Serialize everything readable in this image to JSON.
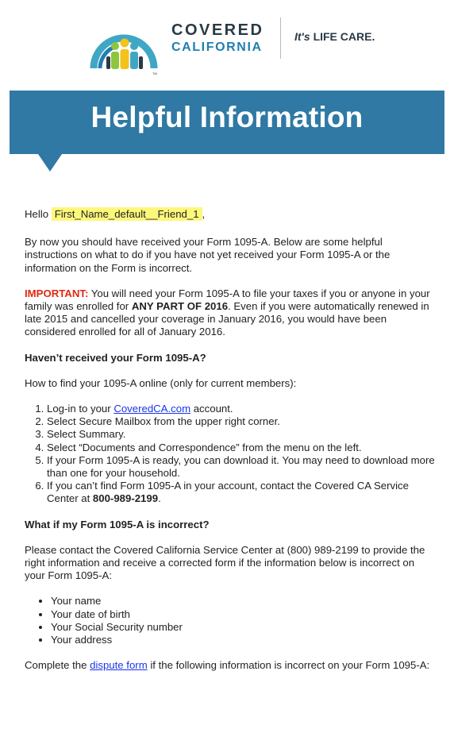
{
  "header": {
    "brand_line1": "COVERED",
    "brand_line2": "CALIFORNIA",
    "tm": "TM",
    "tagline_its": "It's",
    "tagline_rest": "LIFE CARE."
  },
  "banner": {
    "title": "Helpful Information"
  },
  "greeting": {
    "prefix": "Hello",
    "name": "First_Name_default__Friend_1",
    "suffix": ","
  },
  "intro": "By now you should have received your Form 1095-A. Below are some helpful instructions on what to do if you have not yet received your Form 1095-A or the information on the Form is incorrect.",
  "important": {
    "label": "IMPORTANT:",
    "text1": " You will need your Form 1095-A to file your taxes if you or anyone in your family was enrolled for ",
    "bold": "ANY PART OF 2016",
    "text2": ". Even if you were automatically renewed in late 2015 and cancelled your coverage in January 2016, you would have been considered enrolled for all of January 2016."
  },
  "section1": {
    "heading": "Haven’t received your Form 1095-A?",
    "intro": "How to find your 1095-A online (only for current members):",
    "step1_prefix": "Log-in to your ",
    "step1_link": "CoveredCA.com",
    "step1_suffix": " account.",
    "step2": "Select Secure Mailbox from the upper right corner.",
    "step3": "Select Summary.",
    "step4": "Select “Documents and Correspondence” from the menu on the left.",
    "step5": "If your Form 1095-A is ready, you can download it. You may need to download more than one for your household.",
    "step6_prefix": "If you can’t find Form 1095-A in your account, contact the Covered CA Service Center at ",
    "step6_phone": "800-989-2199",
    "step6_suffix": "."
  },
  "section2": {
    "heading": "What if my Form 1095-A is incorrect?",
    "intro": "Please contact the Covered California Service Center at (800) 989-2199 to provide the right information and receive a corrected form if the information below is incorrect on your Form 1095-A:",
    "bullets": [
      "Your name",
      "Your date of birth",
      "Your Social Security number",
      "Your address"
    ],
    "dispute_prefix": "Complete the ",
    "dispute_link": "dispute form",
    "dispute_suffix": " if the following information is incorrect on your Form 1095-A:"
  },
  "colors": {
    "banner": "#2f79a4",
    "brand_blue": "#1f7fb1",
    "brand_dark": "#2b3a44",
    "important_red": "#e02a10",
    "highlight": "#fdf77b",
    "link": "#1a36e8",
    "logo_teal": "#3fa7c4",
    "logo_green": "#8cc63f",
    "logo_yellow": "#f4c21a",
    "logo_blue": "#1f7fb1"
  },
  "icons": [
    "covered-california-logo-icon"
  ]
}
